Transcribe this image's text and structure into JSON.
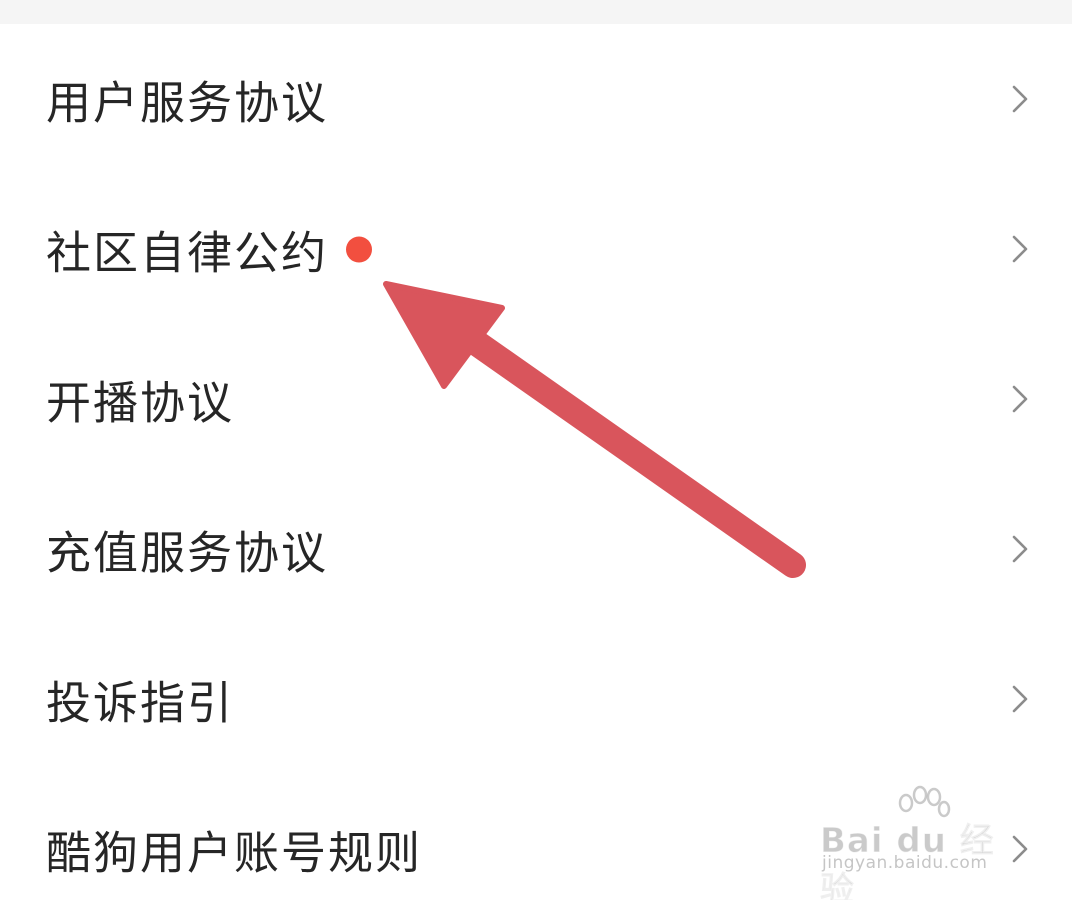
{
  "menu": {
    "items": [
      {
        "label": "用户服务协议",
        "has_dot": false
      },
      {
        "label": "社区自律公约",
        "has_dot": true
      },
      {
        "label": "开播协议",
        "has_dot": false
      },
      {
        "label": "充值服务协议",
        "has_dot": false
      },
      {
        "label": "投诉指引",
        "has_dot": false
      },
      {
        "label": "酷狗用户账号规则",
        "has_dot": false
      }
    ],
    "chevron_icon": "chevron-right-icon"
  },
  "annotation": {
    "arrow_color": "#d9555c",
    "dot_color": "#f24f3f",
    "icon": "arrow-icon"
  },
  "watermark": {
    "logo_text": "Bai du 经验",
    "url": "jingyan.baidu.com"
  }
}
